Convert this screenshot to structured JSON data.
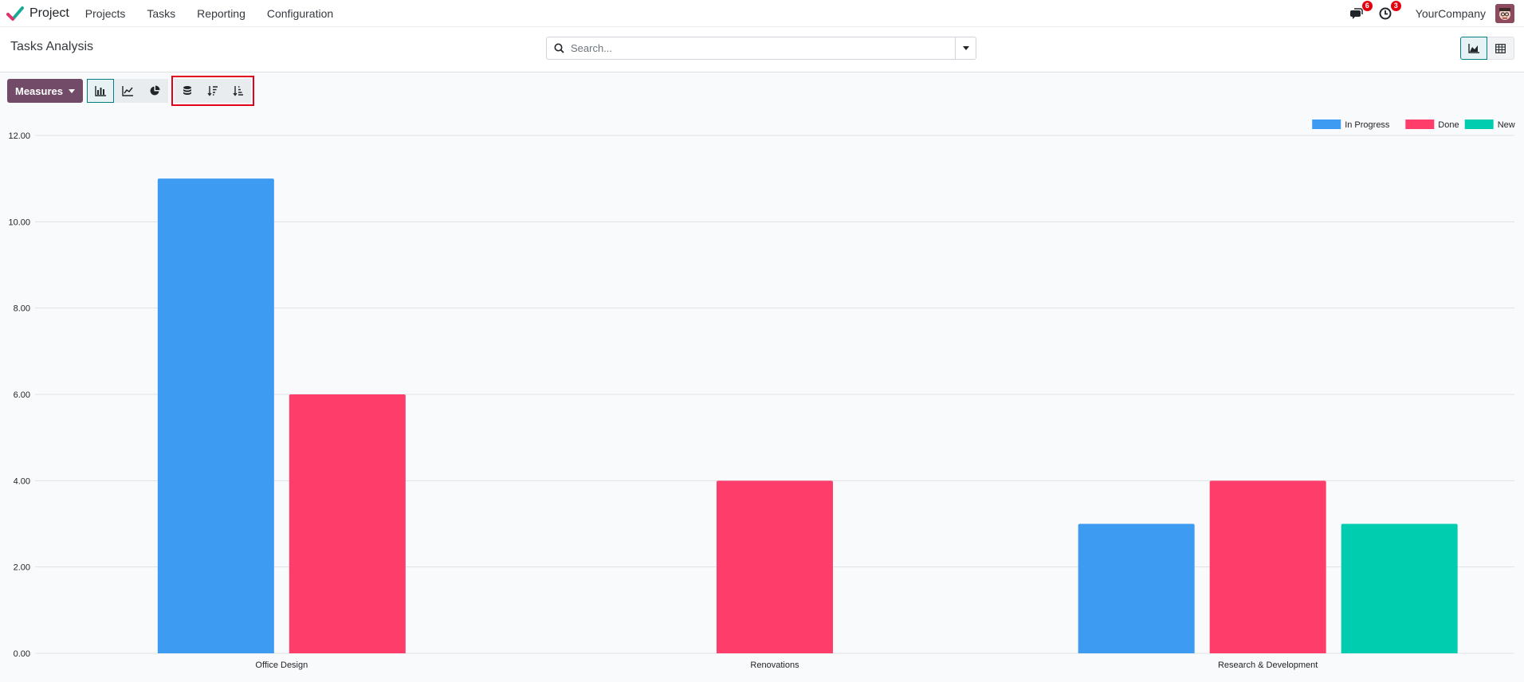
{
  "navbar": {
    "app_name": "Project",
    "menu": [
      "Projects",
      "Tasks",
      "Reporting",
      "Configuration"
    ],
    "messages_badge": "6",
    "activities_badge": "3",
    "company": "YourCompany"
  },
  "control_panel": {
    "title": "Tasks Analysis",
    "search_placeholder": "Search..."
  },
  "toolbar": {
    "measures_label": "Measures"
  },
  "colors": {
    "in_progress": "#3d9bf2",
    "done": "#ff3d6b",
    "new": "#00cdb0",
    "primary": "#714b67",
    "accent": "#017e84"
  },
  "chart_data": {
    "type": "bar",
    "categories": [
      "Office Design",
      "Renovations",
      "Research & Development"
    ],
    "series": [
      {
        "name": "In Progress",
        "values": [
          11,
          0,
          3
        ]
      },
      {
        "name": "Done",
        "values": [
          6,
          4,
          4
        ]
      },
      {
        "name": "New",
        "values": [
          0,
          0,
          3
        ]
      }
    ],
    "yticks": [
      "0.00",
      "2.00",
      "4.00",
      "6.00",
      "8.00",
      "10.00",
      "12.00"
    ],
    "ylim": [
      0,
      12
    ],
    "grid": true,
    "legend_position": "top-right"
  }
}
